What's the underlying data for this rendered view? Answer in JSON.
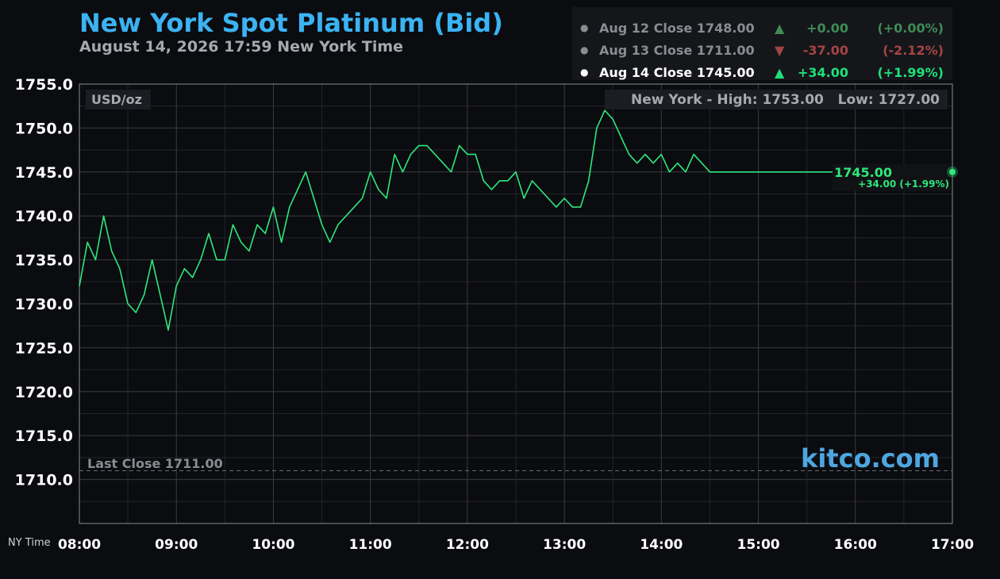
{
  "header": {
    "title": "New York Spot Platinum (Bid)",
    "subtitle": "August 14, 2026 17:59 New York Time"
  },
  "closes": [
    {
      "label": "Aug 12 Close 1748.00",
      "arrow": "▲",
      "change": "+0.00",
      "pct": "(+0.00%)",
      "active": false,
      "direction": "up"
    },
    {
      "label": "Aug 13 Close 1711.00",
      "arrow": "▼",
      "change": "-37.00",
      "pct": "(-2.12%)",
      "active": false,
      "direction": "down"
    },
    {
      "label": "Aug 14 Close 1745.00",
      "arrow": "▲",
      "change": "+34.00",
      "pct": "(+1.99%)",
      "active": true,
      "direction": "up"
    }
  ],
  "colors": {
    "title": "#3bb3f3",
    "line": "#2ee87a",
    "up": "#1fe07a",
    "up_dim": "#3f8a55",
    "down_dim": "#a34545",
    "grid": "#3a3b40",
    "background": "#0b0c10"
  },
  "chart_data": {
    "type": "line",
    "unit_label": "USD/oz",
    "high_low_label": "New York - High: 1753.00   Low: 1727.00",
    "last_close_label": "Last Close 1711.00",
    "last_close": 1711.0,
    "current_value_label": "1745.00",
    "current_change_label": "+34.00 (+1.99%)",
    "watermark": "kitco.com",
    "xlabel": "NY Time",
    "ylim": [
      1705,
      1755
    ],
    "yticks": [
      1710,
      1715,
      1720,
      1725,
      1730,
      1735,
      1740,
      1745,
      1750,
      1755
    ],
    "ytick_labels": [
      "1710.0",
      "1715.0",
      "1720.0",
      "1725.0",
      "1730.0",
      "1735.0",
      "1740.0",
      "1745.0",
      "1750.0",
      "1755.0"
    ],
    "xlim": [
      "08:00",
      "17:00"
    ],
    "xticks": [
      "08:00",
      "09:00",
      "10:00",
      "11:00",
      "12:00",
      "13:00",
      "14:00",
      "15:00",
      "16:00",
      "17:00"
    ],
    "grid": true,
    "series": [
      {
        "x": [
          "08:00",
          "08:05",
          "08:10",
          "08:15",
          "08:20",
          "08:25",
          "08:30",
          "08:35",
          "08:40",
          "08:45",
          "08:50",
          "08:55",
          "09:00",
          "09:05",
          "09:10",
          "09:15",
          "09:20",
          "09:25",
          "09:30",
          "09:35",
          "09:40",
          "09:45",
          "09:50",
          "09:55",
          "10:00",
          "10:05",
          "10:10",
          "10:15",
          "10:20",
          "10:25",
          "10:30",
          "10:35",
          "10:40",
          "10:45",
          "10:50",
          "10:55",
          "11:00",
          "11:05",
          "11:10",
          "11:15",
          "11:20",
          "11:25",
          "11:30",
          "11:35",
          "11:40",
          "11:45",
          "11:50",
          "11:55",
          "12:00",
          "12:05",
          "12:10",
          "12:15",
          "12:20",
          "12:25",
          "12:30",
          "12:35",
          "12:40",
          "12:45",
          "12:50",
          "12:55",
          "13:00",
          "13:05",
          "13:10",
          "13:15",
          "13:20",
          "13:25",
          "13:30",
          "13:35",
          "13:40",
          "13:45",
          "13:50",
          "13:55",
          "14:00",
          "14:05",
          "14:10",
          "14:15",
          "14:20",
          "14:25",
          "14:30",
          "14:35",
          "14:40",
          "14:45",
          "14:50",
          "14:55",
          "15:00",
          "15:05",
          "15:10",
          "15:15",
          "15:20",
          "15:25",
          "15:30",
          "15:35",
          "15:40",
          "15:45",
          "15:50",
          "15:55",
          "16:00",
          "16:05",
          "16:10",
          "16:15",
          "16:20",
          "16:25",
          "16:30",
          "16:35",
          "16:40",
          "16:45",
          "16:50",
          "16:55",
          "17:00"
        ],
        "values": [
          1732,
          1737,
          1735,
          1740,
          1736,
          1734,
          1730,
          1729,
          1731,
          1735,
          1731,
          1727,
          1732,
          1734,
          1733,
          1735,
          1738,
          1735,
          1735,
          1739,
          1737,
          1736,
          1739,
          1738,
          1741,
          1737,
          1741,
          1743,
          1745,
          1742,
          1739,
          1737,
          1739,
          1740,
          1741,
          1742,
          1745,
          1743,
          1742,
          1747,
          1745,
          1747,
          1748,
          1748,
          1747,
          1746,
          1745,
          1748,
          1747,
          1747,
          1744,
          1743,
          1744,
          1744,
          1745,
          1742,
          1744,
          1743,
          1742,
          1741,
          1742,
          1741,
          1741,
          1744,
          1750,
          1752,
          1751,
          1749,
          1747,
          1746,
          1747,
          1746,
          1747,
          1745,
          1746,
          1745,
          1747,
          1746,
          1745,
          1745,
          1745,
          1745,
          1745,
          1745,
          1745,
          1745,
          1745,
          1745,
          1745,
          1745,
          1745,
          1745,
          1745,
          1745,
          1745,
          1745,
          1745,
          1745,
          1745,
          1745,
          1745,
          1745,
          1745,
          1745,
          1745,
          1745,
          1745,
          1745,
          1745
        ]
      }
    ]
  }
}
